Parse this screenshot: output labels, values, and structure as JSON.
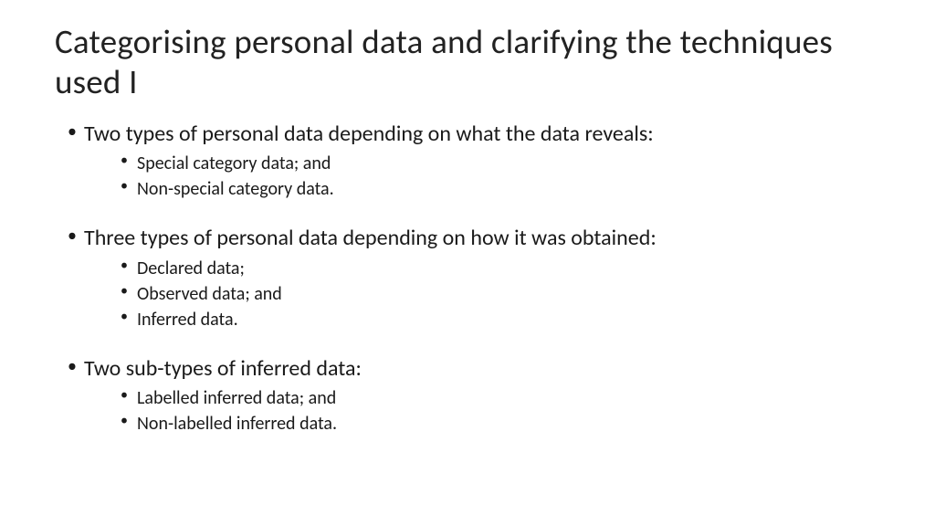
{
  "title": "Categorising personal data and clarifying the techniques used I",
  "items": [
    {
      "text": "Two types of personal data depending on what the data reveals:",
      "sub": [
        "Special category data; and",
        "Non-special category data."
      ]
    },
    {
      "text": "Three types of personal data depending on how it was obtained:",
      "sub": [
        "Declared data;",
        "Observed data; and",
        "Inferred data."
      ]
    },
    {
      "text": "Two sub-types of inferred data:",
      "sub": [
        "Labelled inferred data; and",
        "Non-labelled inferred data."
      ]
    }
  ]
}
